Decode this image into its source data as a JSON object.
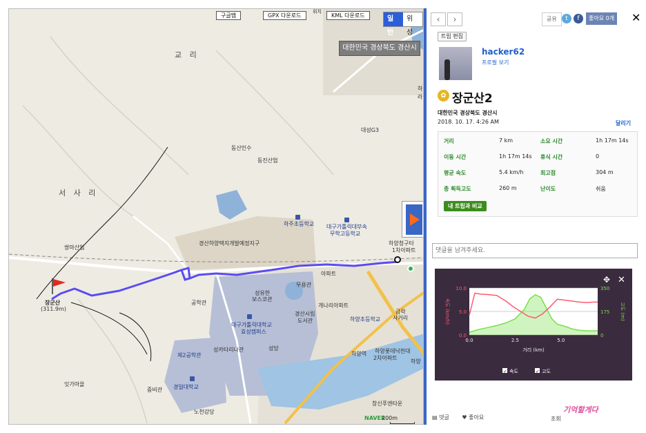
{
  "map": {
    "buttons": {
      "print": "구글맵",
      "gpx": "GPX 다운로드",
      "kml": "KML 다운로드",
      "normal": "일반",
      "satellite": "위성"
    },
    "top_label": "위치",
    "region": "대한민국 경상북도 경산시",
    "labels": {
      "gyori": "교 리",
      "seosari": "서 사 리",
      "ssanga": "쌍마산업",
      "peak_name": "장군산",
      "peak_alt": "(311.9m)",
      "dongsan": "동산인수",
      "dongjin": "동진산업",
      "daesung": "대성G3",
      "district": "경산하양택지개발예정지구",
      "haju_school": "하주초등학교",
      "daegu_cath_school": "대구가톨릭대부속",
      "daegu_cath_school2": "무학고등학교",
      "hayang_apt": "하양청구타",
      "hayang_apt2": "1차아파트",
      "apt": "아파트",
      "muyong": "무용관",
      "gongha": "공학관",
      "seongyu": "성유한",
      "seongyu2": "보스코관",
      "univ": "대구가톨릭대학교",
      "univ2": "효성캠퍼스",
      "library": "경산시립",
      "library2": "도서관",
      "genari": "개나리아파트",
      "hayang_elem": "하양초등학교",
      "sagyeori": "사거리",
      "gongak": "금락",
      "seongdang": "성당",
      "sgc": "성카타리나관",
      "hayang_station": "하양역",
      "hayang_lotte": "하양롯데낙천대",
      "hayang_lotte2": "2차아파트",
      "hayang_ri": "하양",
      "gongdae2": "제2공학관",
      "kyungil": "경일대학교",
      "jungbi": "중비관",
      "nocheon": "노천강당",
      "itgamaeul": "잇가마을",
      "changsin": "창신푸엔타운",
      "ha_right": "하",
      "ra_right": "라"
    },
    "naver": "NAVER",
    "scale": "200m"
  },
  "panel": {
    "share_label": "공유",
    "like_label": "좋아요 0개",
    "trip_edit": "트립 편집",
    "username": "hacker62",
    "profile_link": "프로필 보기",
    "trip_title": "장군산2",
    "location": "대한민국 경상북도 경산시",
    "date": "2018. 10. 17. 4:26 AM",
    "activity": "달리기",
    "stats": [
      {
        "label": "거리",
        "value": "7 km",
        "label2": "소요 시간",
        "value2": "1h 17m 14s"
      },
      {
        "label": "이동 시간",
        "value": "1h 17m 14s",
        "label2": "휴식 시간",
        "value2": "0"
      },
      {
        "label": "평균 속도",
        "value": "5.4 km/h",
        "label2": "최고점",
        "value2": "304 m"
      },
      {
        "label": "총 획득고도",
        "value": "260 m",
        "label2": "난이도",
        "value2": "쉬움"
      }
    ],
    "compare_btn": "내 트립과 비교",
    "comment_placeholder": "댓글을 남겨주세요.",
    "comment_label": "댓글",
    "like_footer": "좋아요",
    "views_label": "조회",
    "watermark": "기억할게다"
  },
  "chart_data": {
    "type": "line",
    "xlabel": "거리 (km)",
    "ylabel_left": "속도 (km/h)",
    "ylabel_right": "고도 (m)",
    "xlim": [
      0,
      7
    ],
    "ylim_left": [
      0,
      10.0
    ],
    "ylim_right": [
      0,
      350
    ],
    "x_ticks": [
      "0.0",
      "2.5",
      "5.0"
    ],
    "y_ticks_left": [
      "10.0",
      "5.0",
      "0.0"
    ],
    "y_ticks_right": [
      "350",
      "175",
      "0"
    ],
    "series": [
      {
        "name": "속도",
        "color": "#ff5a6e",
        "x": [
          0,
          0.3,
          0.6,
          1.0,
          1.5,
          2.0,
          2.4,
          2.8,
          3.2,
          3.6,
          4.0,
          4.4,
          4.8,
          5.2,
          5.6,
          6.0,
          6.4,
          6.8,
          7.0
        ],
        "values": [
          4.2,
          8.9,
          8.7,
          8.6,
          8.4,
          7.2,
          6.0,
          5.0,
          4.0,
          3.6,
          4.5,
          6.0,
          7.6,
          7.4,
          7.2,
          7.0,
          6.9,
          7.0,
          7.0
        ]
      },
      {
        "name": "고도",
        "color": "#77e04a",
        "x": [
          0,
          0.5,
          1.0,
          1.5,
          2.0,
          2.5,
          3.0,
          3.3,
          3.6,
          3.9,
          4.2,
          4.5,
          4.8,
          5.2,
          5.6,
          6.0,
          6.5,
          7.0
        ],
        "values": [
          20,
          40,
          55,
          70,
          90,
          120,
          190,
          270,
          300,
          280,
          200,
          120,
          80,
          65,
          45,
          35,
          30,
          30
        ]
      }
    ],
    "legend": [
      "속도",
      "고도"
    ],
    "grid": true
  }
}
